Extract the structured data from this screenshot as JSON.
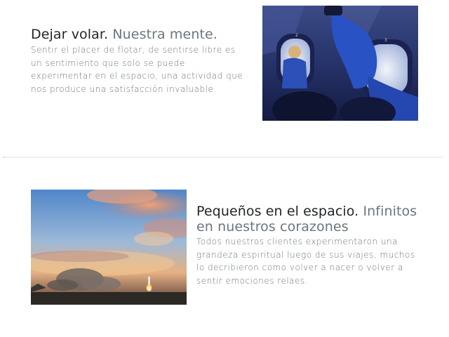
{
  "feature_1": {
    "heading": "Dejar volar.",
    "heading_muted": "Nuestra mente.",
    "text": "Sentir el placer de flotar, de sentirse libre es un sentimiento que solo se puede experimentar en el espacio, una actividad que nos produce una satisfacción invaluable.",
    "image_label": "Astronautas flotando dentro de la cápsula espacial"
  },
  "feature_2": {
    "heading": "Pequeños en el espacio.",
    "heading_muted": "Infinitos en nuestros corazones",
    "text": "Todos nuestros clientes experimentaron una grandeza espiritual luego de sus viajes, muchos lo decribieron como volver a nacer o volver a sentir emociones relaes.",
    "image_label": "Lanzamiento de cohete al atardecer"
  }
}
